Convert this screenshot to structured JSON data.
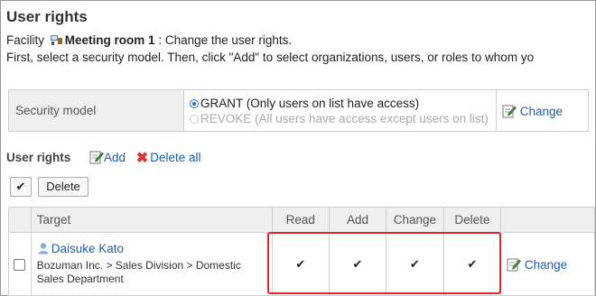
{
  "page": {
    "title": "User rights"
  },
  "facility": {
    "label": "Facility",
    "name": "Meeting room 1",
    "suffix": ": Change the user rights."
  },
  "instructions": "First, select a security model. Then, click \"Add\" to select organizations, users, or roles to whom yo",
  "security_model": {
    "label": "Security model",
    "option_grant": "GRANT (Only users on list have access)",
    "option_revoke": "REVOKE (All users have access except users on list)",
    "selected": "GRANT",
    "change_label": "Change"
  },
  "user_rights": {
    "heading": "User rights",
    "add_label": "Add",
    "delete_all_label": "Delete all",
    "select_all_glyph": "✔",
    "delete_button": "Delete",
    "columns": {
      "target": "Target",
      "read": "Read",
      "add": "Add",
      "change": "Change",
      "delete": "Delete"
    },
    "rows": [
      {
        "user": "Daisuke Kato",
        "organization": "Bozuman Inc. > Sales Division > Domestic Sales Department",
        "read": "✔",
        "add": "✔",
        "change": "✔",
        "delete": "✔",
        "change_label": "Change"
      }
    ]
  },
  "colors": {
    "link": "#1a5fb4",
    "highlight": "#e0262a",
    "header_bg": "#efefef"
  }
}
